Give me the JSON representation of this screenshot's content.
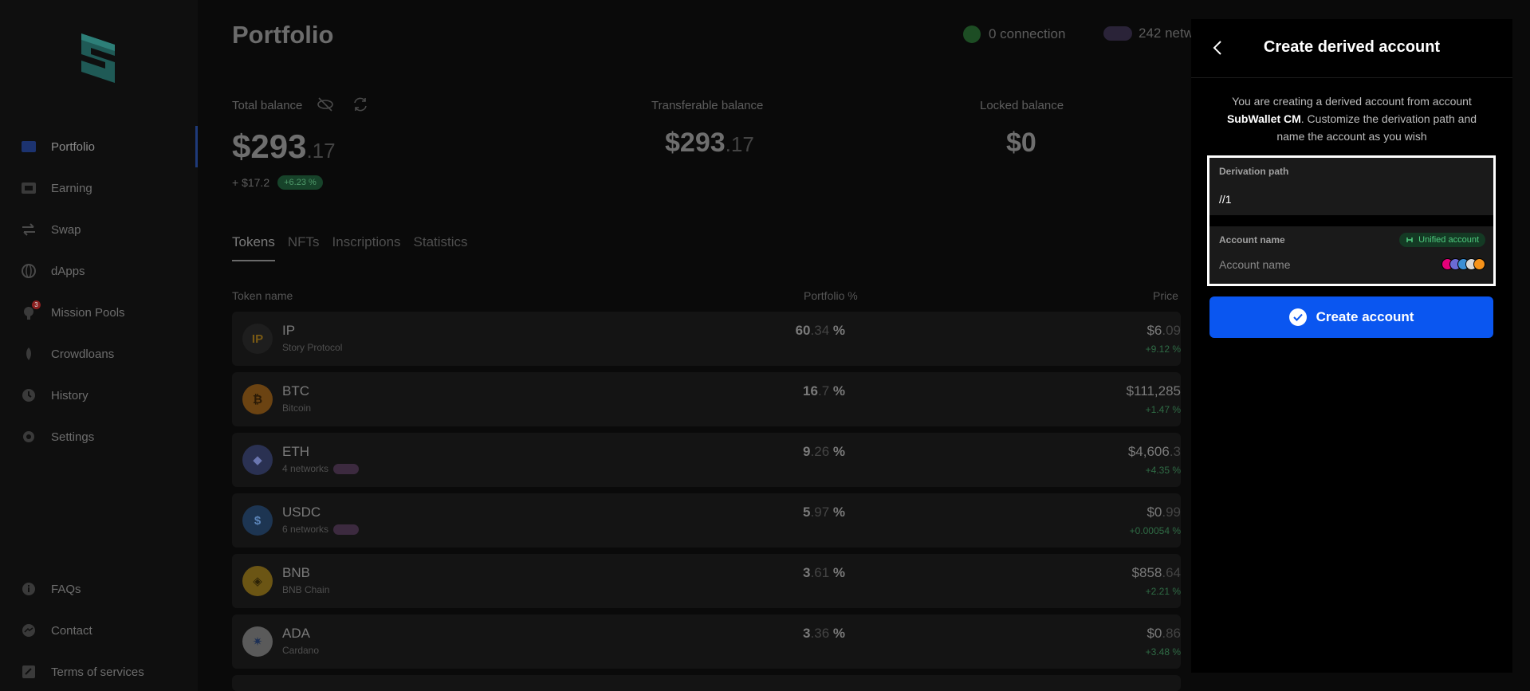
{
  "sidebar": {
    "items": [
      {
        "label": "Portfolio"
      },
      {
        "label": "Earning"
      },
      {
        "label": "Swap"
      },
      {
        "label": "dApps"
      },
      {
        "label": "Mission Pools",
        "badge": "3"
      },
      {
        "label": "Crowdloans"
      },
      {
        "label": "History"
      },
      {
        "label": "Settings"
      }
    ],
    "bottom_items": [
      {
        "label": "FAQs"
      },
      {
        "label": "Contact"
      },
      {
        "label": "Terms of services"
      }
    ]
  },
  "header": {
    "title": "Portfolio",
    "connection": "0 connection",
    "networks": "242 netw"
  },
  "balances": {
    "total_label": "Total balance",
    "total_int": "$293",
    "total_dec": ".17",
    "change": "+ $17.2",
    "change_pct": "+6.23 %",
    "transferable_label": "Transferable balance",
    "transferable_int": "$293",
    "transferable_dec": ".17",
    "locked_label": "Locked balance",
    "locked_value": "$0"
  },
  "tabs": [
    "Tokens",
    "NFTs",
    "Inscriptions",
    "Statistics"
  ],
  "table": {
    "headers": {
      "token": "Token name",
      "portfolio": "Portfolio %",
      "price": "Price"
    },
    "rows": [
      {
        "symbol": "IP",
        "name": "Story Protocol",
        "pct_int": "60",
        "pct_dec": ".34",
        "price_int": "$6",
        "price_dec": ".09",
        "change": "+9.12 %"
      },
      {
        "symbol": "BTC",
        "name": "Bitcoin",
        "pct_int": "16",
        "pct_dec": ".7",
        "price_int": "$111,285",
        "price_dec": "",
        "change": "+1.47 %"
      },
      {
        "symbol": "ETH",
        "name": "4 networks",
        "pct_int": "9",
        "pct_dec": ".26",
        "price_int": "$4,606",
        "price_dec": ".3",
        "change": "+4.35 %"
      },
      {
        "symbol": "USDC",
        "name": "6 networks",
        "pct_int": "5",
        "pct_dec": ".97",
        "price_int": "$0",
        "price_dec": ".99",
        "change": "+0.00054 %"
      },
      {
        "symbol": "BNB",
        "name": "BNB Chain",
        "pct_int": "3",
        "pct_dec": ".61",
        "price_int": "$858",
        "price_dec": ".64",
        "change": "+2.21 %"
      },
      {
        "symbol": "ADA",
        "name": "Cardano",
        "pct_int": "3",
        "pct_dec": ".36",
        "price_int": "$0",
        "price_dec": ".86",
        "change": "+3.48 %"
      }
    ]
  },
  "modal": {
    "title": "Create derived account",
    "desc_prefix": "You are creating a derived account from account ",
    "desc_account": "SubWallet CM",
    "desc_suffix": ". Customize the derivation path and name the account as you wish",
    "derivation_label": "Derivation path",
    "derivation_value": "//1",
    "account_name_label": "Account name",
    "account_name_placeholder": "Account name",
    "unified_badge": "Unified account",
    "create_button": "Create account"
  },
  "colors": {
    "accent": "#0a56f0",
    "unified_green": "#4ecb7e"
  }
}
